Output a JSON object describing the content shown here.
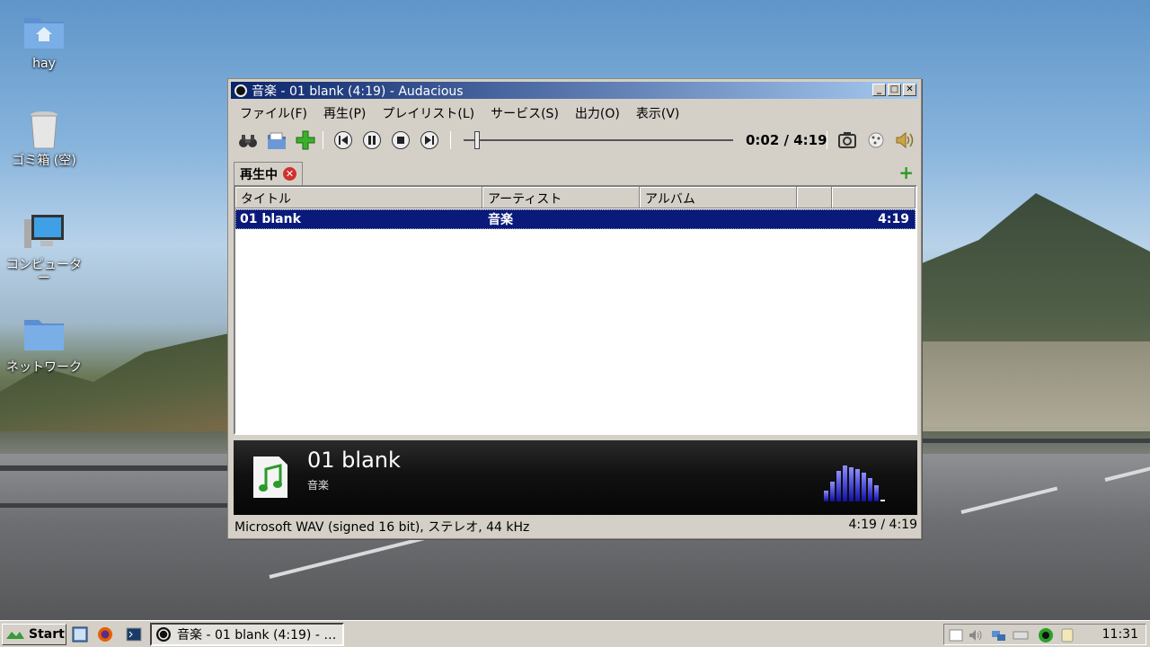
{
  "desktop": {
    "icons": [
      {
        "label": "hay",
        "icon": "home-folder-icon"
      },
      {
        "label": "ゴミ箱 (空)",
        "icon": "trash-icon"
      },
      {
        "label": "コンピューター",
        "icon": "computer-icon"
      },
      {
        "label": "ネットワーク",
        "icon": "network-folder-icon"
      }
    ]
  },
  "window": {
    "title": "音楽 - 01 blank (4:19) - Audacious",
    "menu": [
      "ファイル(F)",
      "再生(P)",
      "プレイリスト(L)",
      "サービス(S)",
      "出力(O)",
      "表示(V)"
    ],
    "time_display": "0:02 / 4:19",
    "playlist_tab": "再生中",
    "columns": [
      "タイトル",
      "アーティスト",
      "アルバム",
      "",
      ""
    ],
    "rows": [
      {
        "title": "01 blank",
        "artist": "音楽",
        "album": "",
        "length": "4:19"
      }
    ],
    "now_playing": {
      "title": "01 blank",
      "artist": "音楽"
    },
    "status_left": "Microsoft WAV (signed 16 bit), ステレオ, 44 kHz",
    "status_right": "4:19 / 4:19",
    "seek_fraction": 0.008
  },
  "taskbar": {
    "start_label": "Start",
    "task_label": "音楽 - 01 blank (4:19) - …",
    "clock": "11:31"
  },
  "colors": {
    "selection": "#0a1a7a",
    "titlebar": "#0a246a",
    "add_green": "#2c9a20"
  }
}
